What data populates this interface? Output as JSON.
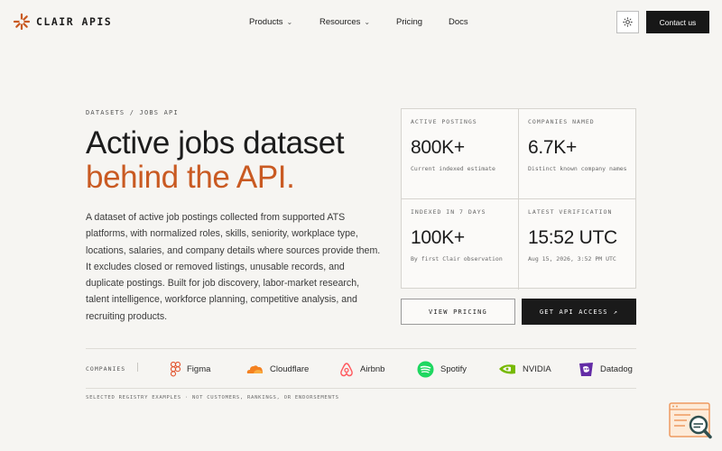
{
  "brand": {
    "name": "CLAIR APIS",
    "accent": "#c95a22"
  },
  "nav": {
    "items": [
      {
        "label": "Products",
        "has_dropdown": true
      },
      {
        "label": "Resources",
        "has_dropdown": true
      },
      {
        "label": "Pricing",
        "has_dropdown": false
      },
      {
        "label": "Docs",
        "has_dropdown": false
      }
    ],
    "theme_icon": "sun-icon",
    "contact_label": "Contact us"
  },
  "hero": {
    "breadcrumb": "DATASETS / JOBS API",
    "title_line1": "Active jobs dataset",
    "title_line2": "behind the API.",
    "description": "A dataset of active job postings collected from supported ATS platforms, with normalized roles, skills, seniority, workplace type, locations, salaries, and company details where sources provide them. It excludes closed or removed listings, unusable records, and duplicate postings. Built for job discovery, labor-market research, talent intelligence, workforce planning, competitive analysis, and recruiting products."
  },
  "stats": [
    {
      "label": "ACTIVE POSTINGS",
      "value": "800K+",
      "sub": "Current indexed estimate"
    },
    {
      "label": "COMPANIES NAMED",
      "value": "6.7K+",
      "sub": "Distinct known company names"
    },
    {
      "label": "INDEXED IN 7 DAYS",
      "value": "100K+",
      "sub": "By first Clair observation"
    },
    {
      "label": "LATEST VERIFICATION",
      "value": "15:52 UTC",
      "sub": "Aug 15, 2026, 3:52 PM UTC"
    }
  ],
  "cta": {
    "pricing_label": "VIEW PRICING",
    "access_label": "GET API ACCESS",
    "access_icon": "arrow-up-right-icon"
  },
  "companies": {
    "label": "COMPANIES",
    "items": [
      {
        "name": "Figma",
        "icon": "figma-icon"
      },
      {
        "name": "Cloudflare",
        "icon": "cloudflare-icon"
      },
      {
        "name": "Airbnb",
        "icon": "airbnb-icon"
      },
      {
        "name": "Spotify",
        "icon": "spotify-icon"
      },
      {
        "name": "NVIDIA",
        "icon": "nvidia-icon"
      },
      {
        "name": "Datadog",
        "icon": "datadog-icon"
      }
    ],
    "fineprint": "SELECTED REGISTRY EXAMPLES · NOT CUSTOMERS, RANKINGS, OR ENDORSEMENTS"
  }
}
